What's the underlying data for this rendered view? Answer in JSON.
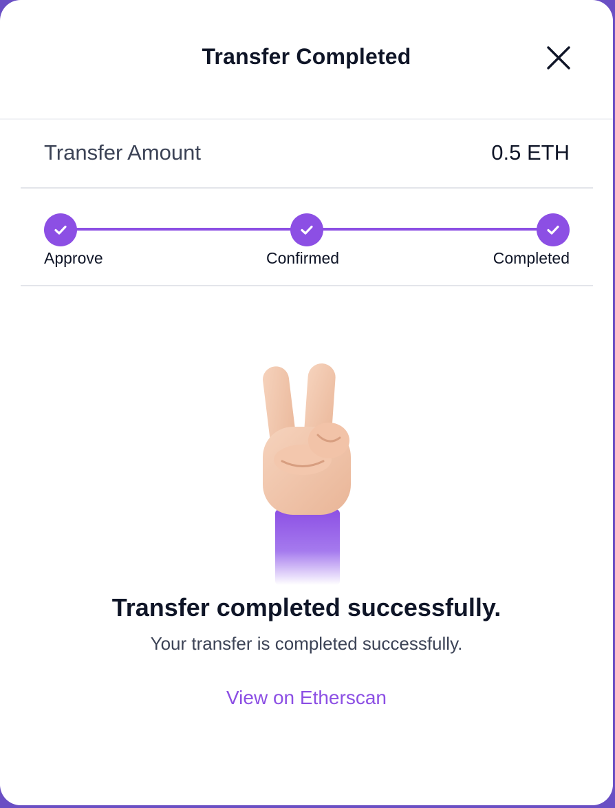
{
  "modal": {
    "title": "Transfer Completed",
    "close_icon": "close-icon"
  },
  "amount": {
    "label": "Transfer Amount",
    "value": "0.5 ETH"
  },
  "steps": [
    {
      "label": "Approve",
      "status": "done",
      "icon": "check-icon"
    },
    {
      "label": "Confirmed",
      "status": "done",
      "icon": "check-icon"
    },
    {
      "label": "Completed",
      "status": "done",
      "icon": "check-icon"
    }
  ],
  "illustration": {
    "icon": "victory-hand-icon"
  },
  "result": {
    "title": "Transfer completed successfully.",
    "subtitle": "Your transfer is completed successfully.",
    "link_label": "View on Etherscan"
  },
  "colors": {
    "accent": "#8c4fe4",
    "text_primary": "#0f1527",
    "text_secondary": "#3c4356",
    "divider": "#e3e5ea",
    "backdrop": "#6a4fc4"
  }
}
